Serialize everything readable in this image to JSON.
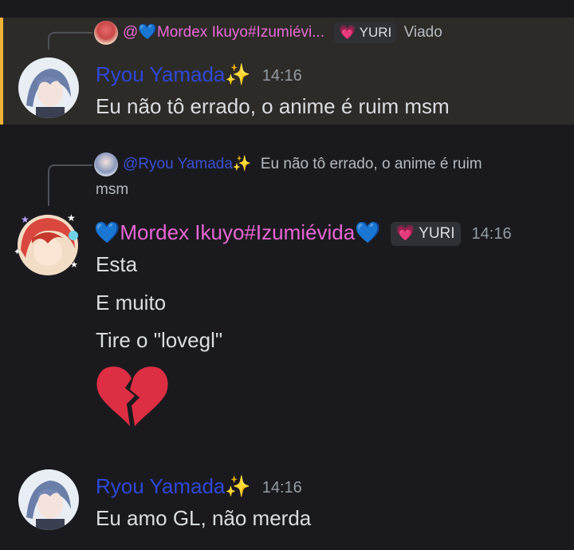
{
  "messages": [
    {
      "reply": {
        "author": "@💙Mordex Ikuyo#Izumiévi...",
        "tag": "💗 YURI",
        "text": "Viado"
      },
      "author": "Ryou Yamada✨",
      "timestamp": "14:16",
      "lines": [
        "Eu não tô errado, o anime é ruim msm"
      ],
      "highlighted": true
    },
    {
      "reply": {
        "author": "@Ryou Yamada✨",
        "text_line1": "Eu não tô errado, o anime é ruim",
        "text_line2": "msm"
      },
      "author": "💙Mordex Ikuyo#Izumiévida💙",
      "tag": "💗 YURI",
      "timestamp": "14:16",
      "lines": [
        "Esta",
        "E muito",
        "Tire o \"lovegl\""
      ],
      "emoji": "broken-heart"
    },
    {
      "author": "Ryou Yamada✨",
      "timestamp": "14:16",
      "lines": [
        "Eu amo GL, não merda"
      ]
    }
  ],
  "colors": {
    "background": "#1a1a1e",
    "highlight_bg": "#2d2b28",
    "highlight_border": "#f0b232",
    "name_blue": "#2f47d8",
    "name_pink": "#e866d4",
    "heart_red": "#dd2e44"
  }
}
